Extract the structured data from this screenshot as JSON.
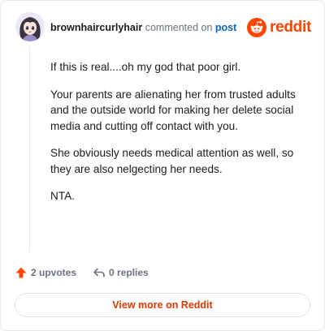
{
  "header": {
    "username": "brownhaircurlyhair",
    "action_text": "commented on",
    "post_link": "post",
    "brand": "reddit"
  },
  "comment": {
    "paragraphs": [
      "If this is real....oh my god that poor girl.",
      "Your parents are alienating her from trusted adults and the outside world for making her delete social media and cutting off contact with you.",
      "She obviously needs medical attention as well, so they are also nelgecting her needs.",
      "NTA."
    ]
  },
  "actions": {
    "upvotes": "2 upvotes",
    "replies": "0 replies"
  },
  "cta": {
    "label": "View more on Reddit"
  },
  "colors": {
    "brand": "#ff4500",
    "upvote": "#ff4500",
    "link": "#0a66c2",
    "cta_text": "#d93a00"
  },
  "icons": {
    "avatar": "anime-girl-avatar",
    "brand": "reddit-snoo-icon",
    "upvote": "upvote-arrow-icon",
    "reply": "reply-arrow-icon"
  }
}
